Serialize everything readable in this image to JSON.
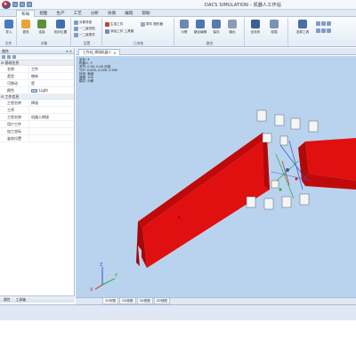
{
  "window": {
    "title": "DACS SIMULATION - 机器人工作站"
  },
  "ribbon": {
    "tabs": [
      "布局",
      "视图",
      "生产",
      "工艺",
      "分析",
      "仿真",
      "编程",
      "帮助"
    ],
    "active_tab": "布局",
    "groups": [
      {
        "label": "文件",
        "buttons": [
          "导入"
        ]
      },
      {
        "label": "对象",
        "buttons": [
          "更改",
          "连接",
          "相对位置"
        ]
      },
      {
        "label": "设置",
        "small": [
          "对象导航",
          "一二级导航",
          "一二级零件"
        ]
      },
      {
        "label": "几何体",
        "small": [
          "生成工件",
          "添加工件 工具箱",
          "零件 图形器"
        ]
      },
      {
        "label": "路径",
        "buttons": [
          "示教",
          "路径编辑",
          "保存",
          "输出"
        ]
      },
      {
        "label": "",
        "buttons": [
          "坐标系",
          "碰撞"
        ]
      },
      {
        "label": "",
        "buttons": [
          "选择工具"
        ]
      }
    ]
  },
  "left_panel": {
    "title": "属性",
    "sections": [
      {
        "name": "基础信息",
        "rows": [
          {
            "key": "名称",
            "value": "工件"
          },
          {
            "key": "类型",
            "value": "物体"
          },
          {
            "key": "可移动",
            "value": "是"
          },
          {
            "key": "颜色",
            "value": "Light"
          }
        ]
      },
      {
        "name": "工作信息",
        "rows": [
          {
            "key": "工程名称",
            "value": "焊接"
          },
          {
            "key": "工序",
            "value": ""
          },
          {
            "key": "工程名称",
            "value": "机器人焊接"
          },
          {
            "key": "用户工件",
            "value": ""
          },
          {
            "key": "加工坐标",
            "value": ""
          },
          {
            "key": "姿态位置",
            "value": ""
          }
        ]
      }
    ],
    "footer": [
      "属性",
      "工具箱"
    ]
  },
  "document": {
    "tab": "工作站_焊接机器人"
  },
  "viewport_info": {
    "lines": [
      "坐标: X",
      "机器人: Y",
      "关节: 0.00, 0.00 仿真",
      "TCP: 0.000, 0.000, 0.000",
      "状态: 就绪",
      "速度: 100",
      "模式: 示教"
    ]
  },
  "bottom_tabs": [
    "3D视图",
    "2D视图",
    "3D视图",
    "2D视图"
  ],
  "colors": {
    "part_red": "#e01010",
    "viewport_bg": "#b9d3ee",
    "frame_bg": "#dfe8f3"
  }
}
